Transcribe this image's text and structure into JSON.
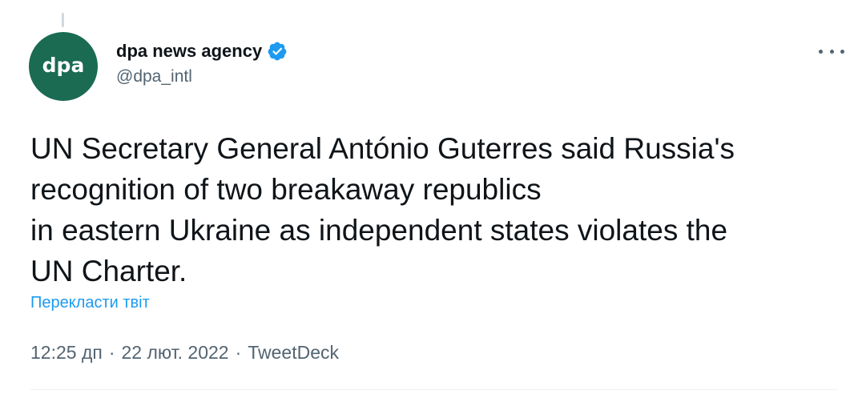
{
  "author": {
    "avatar_text": "dpa",
    "display_name": "dpa news agency",
    "handle": "@dpa_intl",
    "verified_icon": "verified-badge-icon"
  },
  "tweet": {
    "text": "UN Secretary General António Guterres said Russia's\nrecognition of two breakaway republics\nin eastern Ukraine as independent states violates the\nUN Charter.",
    "translate_label": "Перекласти твіт",
    "time": "12:25 дп",
    "date": "22 лют. 2022",
    "separator": "·",
    "source": "TweetDeck"
  },
  "colors": {
    "avatar_bg": "#1a6b52",
    "link": "#1d9bf0",
    "verified": "#1d9bf0",
    "secondary_text": "#536471",
    "primary_text": "#0f1419"
  },
  "icons": {
    "more": "more-horizontal-icon"
  }
}
